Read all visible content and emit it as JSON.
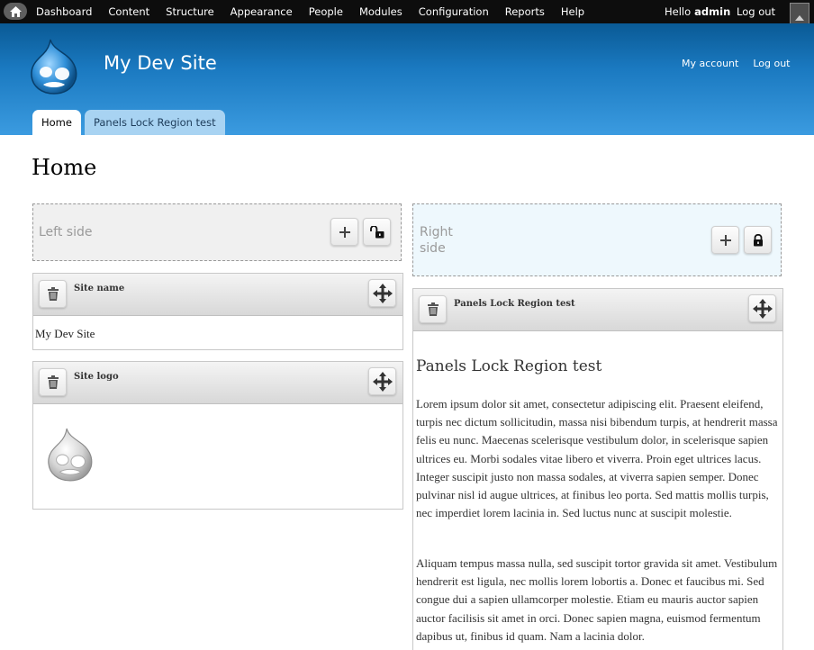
{
  "toolbar": {
    "menu": [
      "Dashboard",
      "Content",
      "Structure",
      "Appearance",
      "People",
      "Modules",
      "Configuration",
      "Reports",
      "Help"
    ],
    "hello": "Hello",
    "user": "admin",
    "logout": "Log out"
  },
  "header": {
    "site_name": "My Dev Site",
    "secondary": [
      "My account",
      "Log out"
    ],
    "tabs": [
      "Home",
      "Panels Lock Region test"
    ]
  },
  "page": {
    "title": "Home"
  },
  "regions": {
    "left": {
      "label": "Left side"
    },
    "right": {
      "label_line1": "Right",
      "label_line2": "side"
    }
  },
  "panes": {
    "site_name": {
      "title": "Site name",
      "content": "My Dev Site"
    },
    "site_logo": {
      "title": "Site logo"
    },
    "lock_test": {
      "title": "Panels Lock Region test",
      "heading": "Panels Lock Region test",
      "p1": "Lorem ipsum dolor sit amet, consectetur adipiscing elit. Praesent eleifend, turpis nec dictum sollicitudin, massa nisi bibendum turpis, at hendrerit massa felis eu nunc. Maecenas scelerisque vestibulum dolor, in scelerisque sapien ultrices eu. Morbi sodales vitae libero et viverra. Proin eget ultrices lacus. Integer suscipit justo non massa sodales, at viverra sapien semper. Donec pulvinar nisl id augue ultrices, at finibus leo porta. Sed mattis mollis turpis, nec imperdiet lorem lacinia in. Sed luctus nunc at suscipit molestie.",
      "p2": "Aliquam tempus massa nulla, sed suscipit tortor gravida sit amet. Vestibulum hendrerit est ligula, nec mollis lorem lobortis a. Donec et faucibus mi. Sed congue dui a sapien ullamcorper molestie. Etiam eu mauris auctor sapien auctor facilisis sit amet in orci. Donec sapien magna, euismod fermentum dapibus ut, finibus id quam. Nam a lacinia dolor."
    }
  },
  "colors": {
    "header_top": "#0a5a95",
    "header_bottom": "#3b9be0",
    "right_region_bg": "#eef8fd",
    "left_region_bg": "#f0f0f0"
  }
}
